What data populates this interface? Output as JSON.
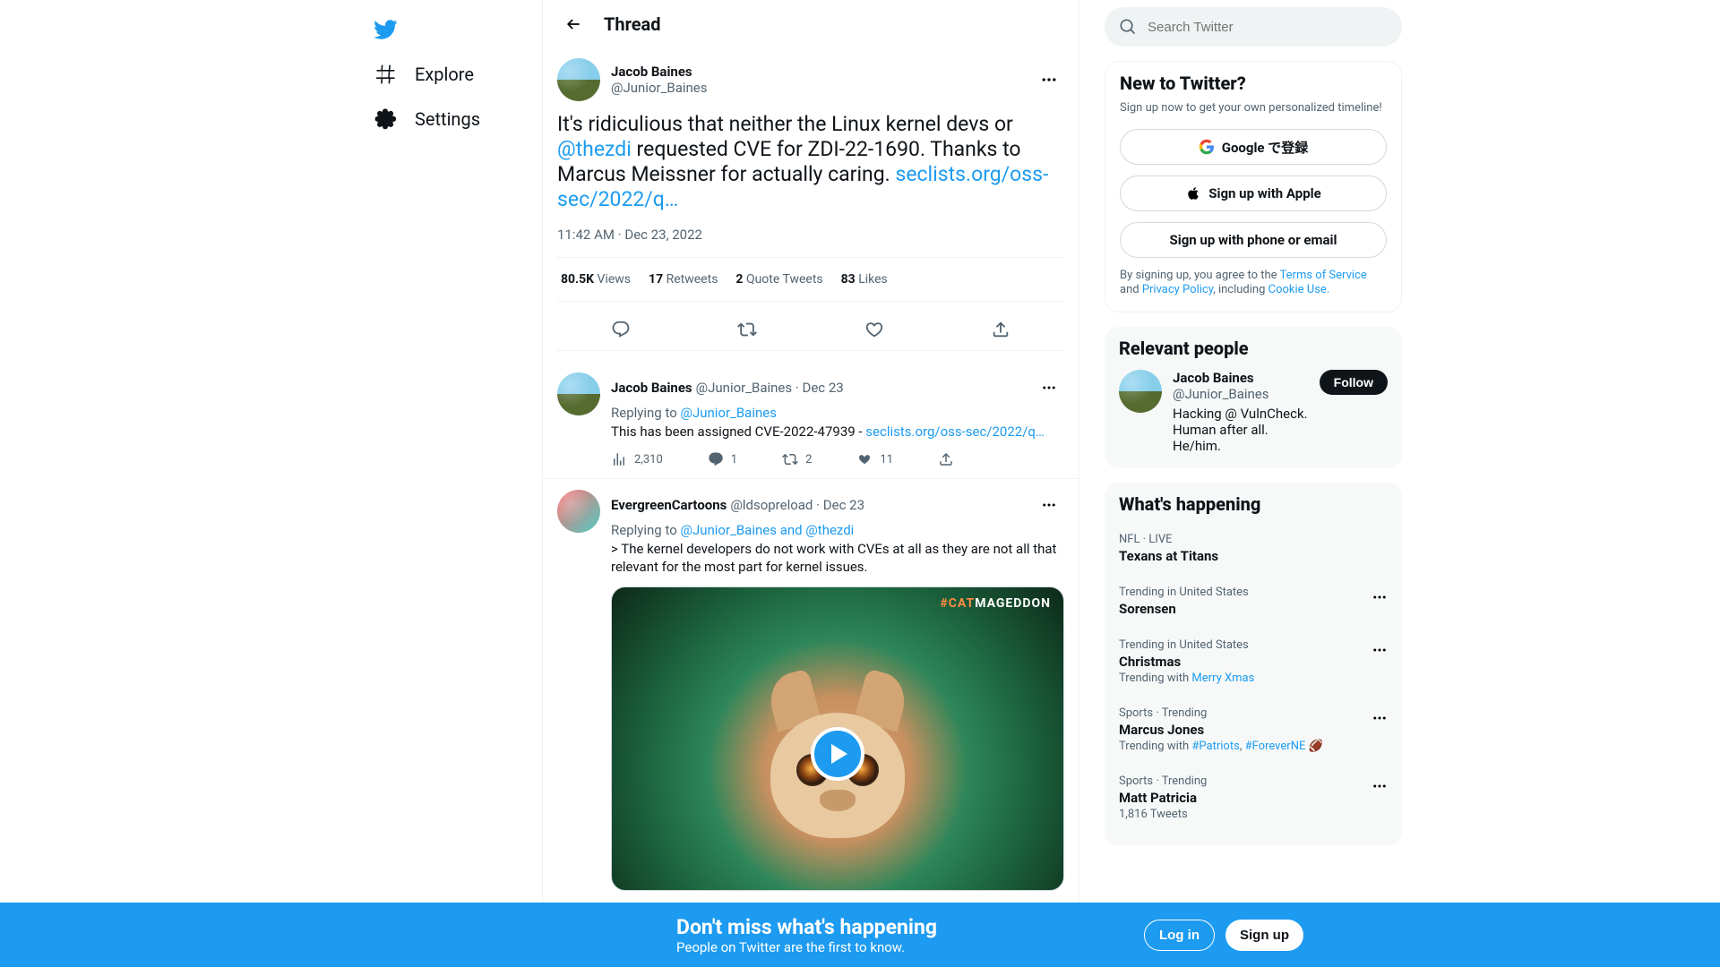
{
  "nav": {
    "explore": "Explore",
    "settings": "Settings"
  },
  "header": {
    "title": "Thread"
  },
  "main_tweet": {
    "author_name": "Jacob Baines",
    "author_handle": "@Junior_Baines",
    "text_part1": "It's ridiculious that neither the Linux kernel devs or ",
    "mention": "@thezdi",
    "text_part2": " requested CVE for ZDI-22-1690. Thanks to Marcus Meissner for actually caring. ",
    "link": "seclists.org/oss-sec/2022/q…",
    "time": "11:42 AM",
    "date": "Dec 23, 2022",
    "views_num": "80.5K",
    "views_lbl": "Views",
    "rt_num": "17",
    "rt_lbl": "Retweets",
    "qt_num": "2",
    "qt_lbl": "Quote Tweets",
    "likes_num": "83",
    "likes_lbl": "Likes"
  },
  "reply1": {
    "author_name": "Jacob Baines",
    "author_handle": "@Junior_Baines",
    "date": "Dec 23",
    "replying_prefix": "Replying to ",
    "replying_to": "@Junior_Baines",
    "text": "This has been assigned CVE-2022-47939 - ",
    "link": "seclists.org/oss-sec/2022/q…",
    "views": "2,310",
    "replies": "1",
    "retweets": "2",
    "likes": "11"
  },
  "reply2": {
    "author_name": "EvergreenCartoons",
    "author_handle": "@ldsopreload",
    "date": "Dec 23",
    "replying_prefix": "Replying to ",
    "replying_to": "@Junior_Baines and @thezdi",
    "text": "> The kernel developers do not work with CVEs at all as they are not all that relevant for the most part for kernel issues.",
    "media_tag_hash": "#CAT",
    "media_tag_rest": "MAGEDDON"
  },
  "search": {
    "placeholder": "Search Twitter"
  },
  "signup": {
    "title": "New to Twitter?",
    "sub": "Sign up now to get your own personalized timeline!",
    "google": "Google で登録",
    "apple": "Sign up with Apple",
    "phone": "Sign up with phone or email",
    "legal_pre": "By signing up, you agree to the ",
    "tos": "Terms of Service",
    "legal_and": " and ",
    "privacy": "Privacy Policy",
    "legal_inc": ", including ",
    "cookie": "Cookie Use."
  },
  "relevant": {
    "title": "Relevant people",
    "name": "Jacob Baines",
    "handle": "@Junior_Baines",
    "bio": "Hacking @ VulnCheck. Human after all. He/him.",
    "follow": "Follow"
  },
  "happening": {
    "title": "What's happening",
    "t0_ctx": "NFL · LIVE",
    "t0_title": "Texans at Titans",
    "t1_ctx": "Trending in United States",
    "t1_title": "Sorensen",
    "t2_ctx": "Trending in United States",
    "t2_title": "Christmas",
    "t2_meta_pre": "Trending with ",
    "t2_meta_link": "Merry Xmas",
    "t3_ctx": "Sports · Trending",
    "t3_title": "Marcus Jones",
    "t3_meta_pre": "Trending with ",
    "t3_meta_link1": "#Patriots",
    "t3_meta_sep": ", ",
    "t3_meta_link2": "#ForeverNE",
    "t4_ctx": "Sports · Trending",
    "t4_title": "Matt Patricia",
    "t4_meta": "1,816 Tweets"
  },
  "banner": {
    "title": "Don't miss what's happening",
    "sub": "People on Twitter are the first to know.",
    "login": "Log in",
    "signup": "Sign up"
  }
}
